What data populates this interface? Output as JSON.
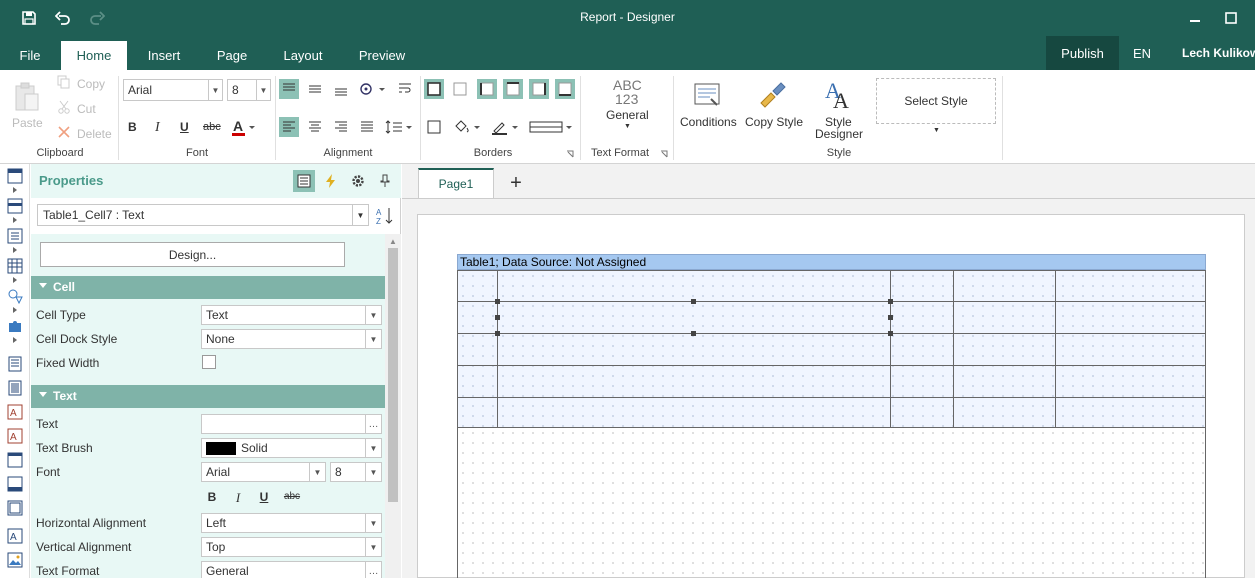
{
  "window": {
    "title": "Report - Designer"
  },
  "menu": {
    "tabs": [
      {
        "label": "File"
      },
      {
        "label": "Home"
      },
      {
        "label": "Insert"
      },
      {
        "label": "Page"
      },
      {
        "label": "Layout"
      },
      {
        "label": "Preview"
      }
    ],
    "publish": "Publish",
    "language": "EN",
    "user": "Lech Kulikowski"
  },
  "ribbon": {
    "clipboard": {
      "paste": "Paste",
      "copy": "Copy",
      "cut": "Cut",
      "delete": "Delete",
      "label": "Clipboard"
    },
    "font": {
      "family": "Arial",
      "size": "8",
      "label": "Font"
    },
    "alignment": {
      "label": "Alignment"
    },
    "borders": {
      "label": "Borders"
    },
    "text_format": {
      "abc": "ABC",
      "num": "123",
      "value": "General",
      "label": "Text Format"
    },
    "style": {
      "conditions": "Conditions",
      "copy_style": "Copy Style",
      "style_designer_1": "Style",
      "style_designer_2": "Designer",
      "select_style": "Select Style",
      "label": "Style"
    }
  },
  "properties": {
    "title": "Properties",
    "selected_object": "Table1_Cell7 : Text",
    "design_button": "Design...",
    "cell_section": "Cell",
    "cell_type_label": "Cell Type",
    "cell_type_value": "Text",
    "cell_dock_label": "Cell Dock Style",
    "cell_dock_value": "None",
    "fixed_width_label": "Fixed Width",
    "text_section": "Text",
    "text_label": "Text",
    "text_value": "",
    "text_brush_label": "Text Brush",
    "text_brush_value": "Solid",
    "font_label": "Font",
    "font_family": "Arial",
    "font_size": "8",
    "bold": "B",
    "italic": "I",
    "underline": "U",
    "strike": "abc",
    "halign_label": "Horizontal Alignment",
    "halign_value": "Left",
    "valign_label": "Vertical Alignment",
    "valign_value": "Top",
    "textformat_label": "Text Format",
    "textformat_value": "General"
  },
  "design": {
    "page_tab": "Page1",
    "add": "+",
    "table_header": "Table1; Data Source: Not Assigned"
  },
  "colors": {
    "accent": "#1f5f55",
    "panel": "#e8f8f5",
    "section": "#7fb3a8",
    "active": "#8cc1b5"
  }
}
